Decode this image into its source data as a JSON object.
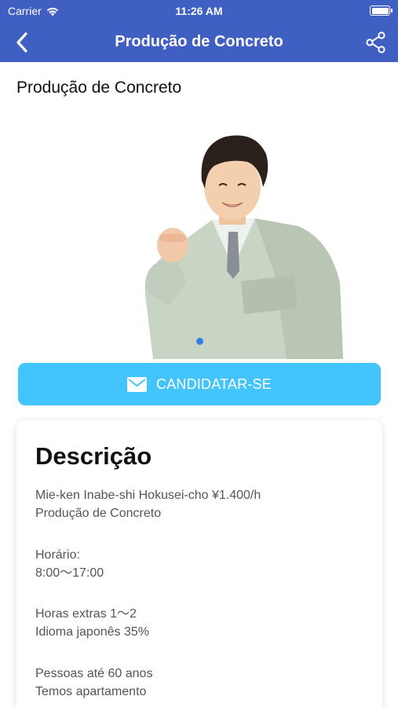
{
  "status_bar": {
    "carrier": "Carrier",
    "time": "11:26 AM",
    "battery_level": 1.0
  },
  "nav": {
    "title": "Produção de Concreto",
    "back_icon": "chevron-left-icon",
    "share_icon": "share-icon"
  },
  "page": {
    "heading": "Produção de Concreto"
  },
  "apply": {
    "label": "CANDIDATAR-SE",
    "icon": "mail-icon"
  },
  "description": {
    "title": "Descrição",
    "blocks": [
      [
        "Mie-ken Inabe-shi Hokusei-cho ¥1.400/h",
        "Produção de Concreto"
      ],
      [
        "Horário:",
        "8:00〜17:00"
      ],
      [
        "Horas extras 1〜2",
        "Idioma japonês 35%"
      ],
      [
        "Pessoas até 60 anos",
        "Temos apartamento"
      ]
    ]
  },
  "colors": {
    "nav_bar": "#3f5fc2",
    "apply_button": "#43c4fb",
    "page_dot": "#2f7fe6"
  }
}
